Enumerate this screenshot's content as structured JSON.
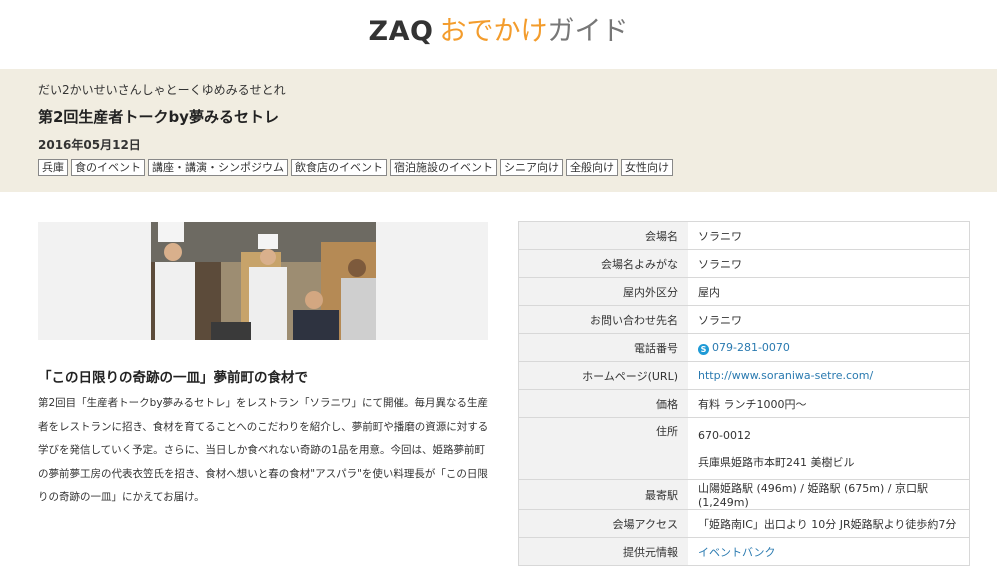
{
  "logo": {
    "zaq": "ZAQ",
    "odekake": "おでかけ",
    "guide": "ガイド"
  },
  "event": {
    "reading": "だい2かいせいさんしゃとーくゆめみるせとれ",
    "title": "第2回生産者トークby夢みるセトレ",
    "date": "2016年05月12日",
    "tags": [
      "兵庫",
      "食のイベント",
      "講座・講演・シンポジウム",
      "飲食店のイベント",
      "宿泊施設のイベント",
      "シニア向け",
      "全般向け",
      "女性向け"
    ]
  },
  "article": {
    "subhead": "「この日限りの奇跡の一皿」夢前町の食材で",
    "description": "第2回目「生産者トークby夢みるセトレ」をレストラン「ソラニワ」にて開催。毎月異なる生産者をレストランに招き、食材を育てることへのこだわりを紹介し、夢前町や播磨の資源に対する学びを発信していく予定。さらに、当日しか食べれない奇跡の1品を用意。今回は、姫路夢前町の夢前夢工房の代表衣笠氏を招き、食材へ想いと春の食材\"アスパラ\"を使い料理長が「この日限りの奇跡の一皿」にかえてお届け。"
  },
  "info": {
    "venue_label": "会場名",
    "venue": "ソラニワ",
    "venue_kana_label": "会場名よみがな",
    "venue_kana": "ソラニワ",
    "indoor_label": "屋内外区分",
    "indoor": "屋内",
    "contact_label": "お問い合わせ先名",
    "contact": "ソラニワ",
    "phone_label": "電話番号",
    "phone_icon": "S",
    "phone": "079-281-0070",
    "homepage_label": "ホームページ(URL)",
    "homepage": "http://www.soraniwa-setre.com/",
    "price_label": "価格",
    "price": "有料 ランチ1000円〜",
    "address_label": "住所",
    "zip": "670-0012",
    "address": "兵庫県姫路市本町241 美樹ビル",
    "station_label": "最寄駅",
    "station": "山陽姫路駅 (496m) / 姫路駅 (675m) / 京口駅 (1,249m)",
    "access_label": "会場アクセス",
    "access": "「姫路南IC」出口より 10分 JR姫路駅より徒歩約7分",
    "source_label": "提供元情報",
    "source": "イベントバンク"
  }
}
